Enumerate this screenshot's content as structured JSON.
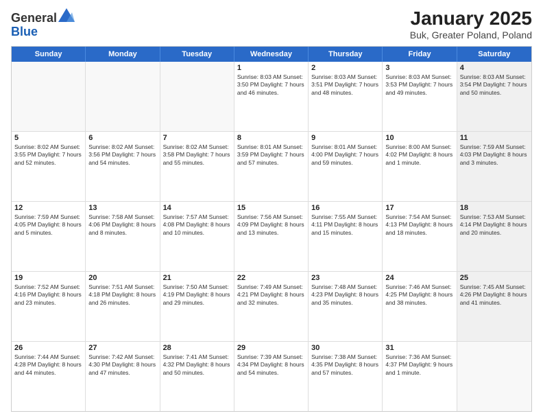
{
  "logo": {
    "general": "General",
    "blue": "Blue"
  },
  "title": "January 2025",
  "subtitle": "Buk, Greater Poland, Poland",
  "header_days": [
    "Sunday",
    "Monday",
    "Tuesday",
    "Wednesday",
    "Thursday",
    "Friday",
    "Saturday"
  ],
  "weeks": [
    [
      {
        "day": "",
        "text": "",
        "shaded": true
      },
      {
        "day": "",
        "text": "",
        "shaded": true
      },
      {
        "day": "",
        "text": "",
        "shaded": true
      },
      {
        "day": "1",
        "text": "Sunrise: 8:03 AM\nSunset: 3:50 PM\nDaylight: 7 hours and 46 minutes."
      },
      {
        "day": "2",
        "text": "Sunrise: 8:03 AM\nSunset: 3:51 PM\nDaylight: 7 hours and 48 minutes."
      },
      {
        "day": "3",
        "text": "Sunrise: 8:03 AM\nSunset: 3:53 PM\nDaylight: 7 hours and 49 minutes."
      },
      {
        "day": "4",
        "text": "Sunrise: 8:03 AM\nSunset: 3:54 PM\nDaylight: 7 hours and 50 minutes.",
        "shaded": true
      }
    ],
    [
      {
        "day": "5",
        "text": "Sunrise: 8:02 AM\nSunset: 3:55 PM\nDaylight: 7 hours and 52 minutes."
      },
      {
        "day": "6",
        "text": "Sunrise: 8:02 AM\nSunset: 3:56 PM\nDaylight: 7 hours and 54 minutes."
      },
      {
        "day": "7",
        "text": "Sunrise: 8:02 AM\nSunset: 3:58 PM\nDaylight: 7 hours and 55 minutes."
      },
      {
        "day": "8",
        "text": "Sunrise: 8:01 AM\nSunset: 3:59 PM\nDaylight: 7 hours and 57 minutes."
      },
      {
        "day": "9",
        "text": "Sunrise: 8:01 AM\nSunset: 4:00 PM\nDaylight: 7 hours and 59 minutes."
      },
      {
        "day": "10",
        "text": "Sunrise: 8:00 AM\nSunset: 4:02 PM\nDaylight: 8 hours and 1 minute."
      },
      {
        "day": "11",
        "text": "Sunrise: 7:59 AM\nSunset: 4:03 PM\nDaylight: 8 hours and 3 minutes.",
        "shaded": true
      }
    ],
    [
      {
        "day": "12",
        "text": "Sunrise: 7:59 AM\nSunset: 4:05 PM\nDaylight: 8 hours and 5 minutes."
      },
      {
        "day": "13",
        "text": "Sunrise: 7:58 AM\nSunset: 4:06 PM\nDaylight: 8 hours and 8 minutes."
      },
      {
        "day": "14",
        "text": "Sunrise: 7:57 AM\nSunset: 4:08 PM\nDaylight: 8 hours and 10 minutes."
      },
      {
        "day": "15",
        "text": "Sunrise: 7:56 AM\nSunset: 4:09 PM\nDaylight: 8 hours and 13 minutes."
      },
      {
        "day": "16",
        "text": "Sunrise: 7:55 AM\nSunset: 4:11 PM\nDaylight: 8 hours and 15 minutes."
      },
      {
        "day": "17",
        "text": "Sunrise: 7:54 AM\nSunset: 4:13 PM\nDaylight: 8 hours and 18 minutes."
      },
      {
        "day": "18",
        "text": "Sunrise: 7:53 AM\nSunset: 4:14 PM\nDaylight: 8 hours and 20 minutes.",
        "shaded": true
      }
    ],
    [
      {
        "day": "19",
        "text": "Sunrise: 7:52 AM\nSunset: 4:16 PM\nDaylight: 8 hours and 23 minutes."
      },
      {
        "day": "20",
        "text": "Sunrise: 7:51 AM\nSunset: 4:18 PM\nDaylight: 8 hours and 26 minutes."
      },
      {
        "day": "21",
        "text": "Sunrise: 7:50 AM\nSunset: 4:19 PM\nDaylight: 8 hours and 29 minutes."
      },
      {
        "day": "22",
        "text": "Sunrise: 7:49 AM\nSunset: 4:21 PM\nDaylight: 8 hours and 32 minutes."
      },
      {
        "day": "23",
        "text": "Sunrise: 7:48 AM\nSunset: 4:23 PM\nDaylight: 8 hours and 35 minutes."
      },
      {
        "day": "24",
        "text": "Sunrise: 7:46 AM\nSunset: 4:25 PM\nDaylight: 8 hours and 38 minutes."
      },
      {
        "day": "25",
        "text": "Sunrise: 7:45 AM\nSunset: 4:26 PM\nDaylight: 8 hours and 41 minutes.",
        "shaded": true
      }
    ],
    [
      {
        "day": "26",
        "text": "Sunrise: 7:44 AM\nSunset: 4:28 PM\nDaylight: 8 hours and 44 minutes."
      },
      {
        "day": "27",
        "text": "Sunrise: 7:42 AM\nSunset: 4:30 PM\nDaylight: 8 hours and 47 minutes."
      },
      {
        "day": "28",
        "text": "Sunrise: 7:41 AM\nSunset: 4:32 PM\nDaylight: 8 hours and 50 minutes."
      },
      {
        "day": "29",
        "text": "Sunrise: 7:39 AM\nSunset: 4:34 PM\nDaylight: 8 hours and 54 minutes."
      },
      {
        "day": "30",
        "text": "Sunrise: 7:38 AM\nSunset: 4:35 PM\nDaylight: 8 hours and 57 minutes."
      },
      {
        "day": "31",
        "text": "Sunrise: 7:36 AM\nSunset: 4:37 PM\nDaylight: 9 hours and 1 minute."
      },
      {
        "day": "",
        "text": "",
        "shaded": true
      }
    ]
  ]
}
